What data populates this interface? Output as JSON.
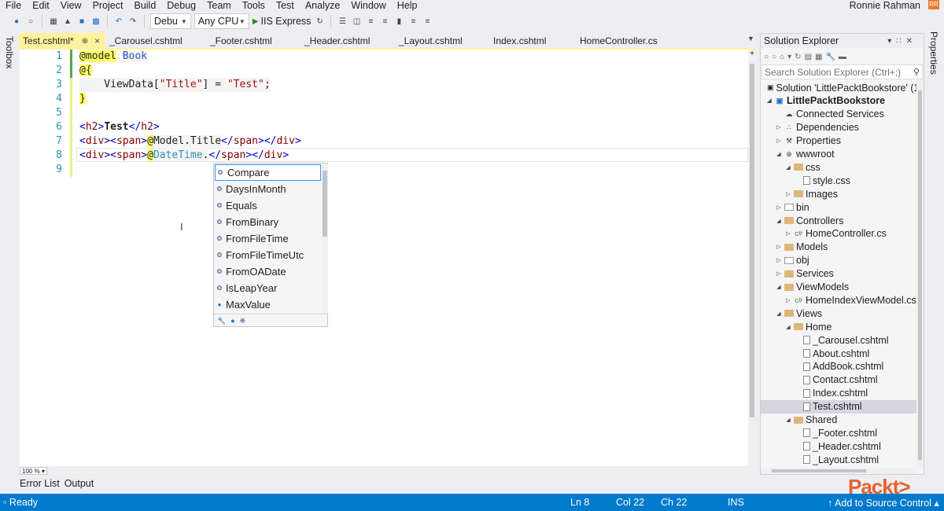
{
  "menu": [
    "File",
    "Edit",
    "View",
    "Project",
    "Build",
    "Debug",
    "Team",
    "Tools",
    "Test",
    "Analyze",
    "Window",
    "Help"
  ],
  "user": {
    "name": "Ronnie Rahman",
    "badge": "RR"
  },
  "toolbar": {
    "config": "Debu",
    "platform": "Any CPU",
    "run_label": "IIS Express"
  },
  "side_strips": {
    "left": "Toolbox",
    "right": "Properties"
  },
  "tabs": [
    {
      "label": "Test.cshtml*",
      "active": true
    },
    {
      "label": "_Carousel.cshtml"
    },
    {
      "label": "_Footer.cshtml"
    },
    {
      "label": "_Header.cshtml"
    },
    {
      "label": "_Layout.cshtml"
    },
    {
      "label": "Index.cshtml"
    },
    {
      "label": "HomeController.cs"
    }
  ],
  "editor": {
    "line_numbers": [
      "1",
      "2",
      "3",
      "4",
      "5",
      "6",
      "7",
      "8",
      "9"
    ],
    "zoom": "100 %"
  },
  "completion": {
    "items": [
      "Compare",
      "DaysInMonth",
      "Equals",
      "FromBinary",
      "FromFileTime",
      "FromFileTimeUtc",
      "FromOADate",
      "IsLeapYear",
      "MaxValue"
    ],
    "selected": "Compare"
  },
  "bottom_tabs": [
    "Error List",
    "Output"
  ],
  "solution_explorer": {
    "title": "Solution Explorer",
    "search_placeholder": "Search Solution Explorer (Ctrl+;)",
    "nodes": [
      {
        "label": "Solution 'LittlePacktBookstore' (1",
        "depth": 0,
        "tw": "",
        "icon": "sln"
      },
      {
        "label": "LittlePacktBookstore",
        "depth": 0,
        "tw": "open",
        "icon": "proj",
        "bold": true
      },
      {
        "label": "Connected Services",
        "depth": 1,
        "tw": "",
        "icon": "cloud"
      },
      {
        "label": "Dependencies",
        "depth": 1,
        "tw": "closed",
        "icon": "deps"
      },
      {
        "label": "Properties",
        "depth": 1,
        "tw": "closed",
        "icon": "wrench"
      },
      {
        "label": "wwwroot",
        "depth": 1,
        "tw": "open",
        "icon": "globe"
      },
      {
        "label": "css",
        "depth": 2,
        "tw": "open",
        "icon": "folder"
      },
      {
        "label": "style.css",
        "depth": 3,
        "tw": "",
        "icon": "file"
      },
      {
        "label": "Images",
        "depth": 2,
        "tw": "closed",
        "icon": "folder"
      },
      {
        "label": "bin",
        "depth": 1,
        "tw": "closed",
        "icon": "gray"
      },
      {
        "label": "Controllers",
        "depth": 1,
        "tw": "open",
        "icon": "folder"
      },
      {
        "label": "HomeController.cs",
        "depth": 2,
        "tw": "closed",
        "icon": "cs"
      },
      {
        "label": "Models",
        "depth": 1,
        "tw": "closed",
        "icon": "folder"
      },
      {
        "label": "obj",
        "depth": 1,
        "tw": "closed",
        "icon": "gray"
      },
      {
        "label": "Services",
        "depth": 1,
        "tw": "closed",
        "icon": "folder"
      },
      {
        "label": "ViewModels",
        "depth": 1,
        "tw": "open",
        "icon": "folder"
      },
      {
        "label": "HomeIndexViewModel.cs",
        "depth": 2,
        "tw": "closed",
        "icon": "cs"
      },
      {
        "label": "Views",
        "depth": 1,
        "tw": "open",
        "icon": "folder"
      },
      {
        "label": "Home",
        "depth": 2,
        "tw": "open",
        "icon": "folder"
      },
      {
        "label": "_Carousel.cshtml",
        "depth": 3,
        "tw": "",
        "icon": "file"
      },
      {
        "label": "About.cshtml",
        "depth": 3,
        "tw": "",
        "icon": "file"
      },
      {
        "label": "AddBook.cshtml",
        "depth": 3,
        "tw": "",
        "icon": "file"
      },
      {
        "label": "Contact.cshtml",
        "depth": 3,
        "tw": "",
        "icon": "file"
      },
      {
        "label": "Index.cshtml",
        "depth": 3,
        "tw": "",
        "icon": "file"
      },
      {
        "label": "Test.cshtml",
        "depth": 3,
        "tw": "",
        "icon": "file",
        "selected": true
      },
      {
        "label": "Shared",
        "depth": 2,
        "tw": "open",
        "icon": "folder"
      },
      {
        "label": "_Footer.cshtml",
        "depth": 3,
        "tw": "",
        "icon": "file"
      },
      {
        "label": "_Header.cshtml",
        "depth": 3,
        "tw": "",
        "icon": "file"
      },
      {
        "label": "_Layout.cshtml",
        "depth": 3,
        "tw": "",
        "icon": "file"
      }
    ]
  },
  "status": {
    "ready": "Ready",
    "ln": "Ln 8",
    "col": "Col 22",
    "ch": "Ch 22",
    "ins": "INS",
    "source_control": "Add to Source Control"
  },
  "watermark": "Packt>",
  "colors": {
    "accent": "#007acc",
    "active_tab": "#fff29d",
    "brand": "#e8602c"
  }
}
